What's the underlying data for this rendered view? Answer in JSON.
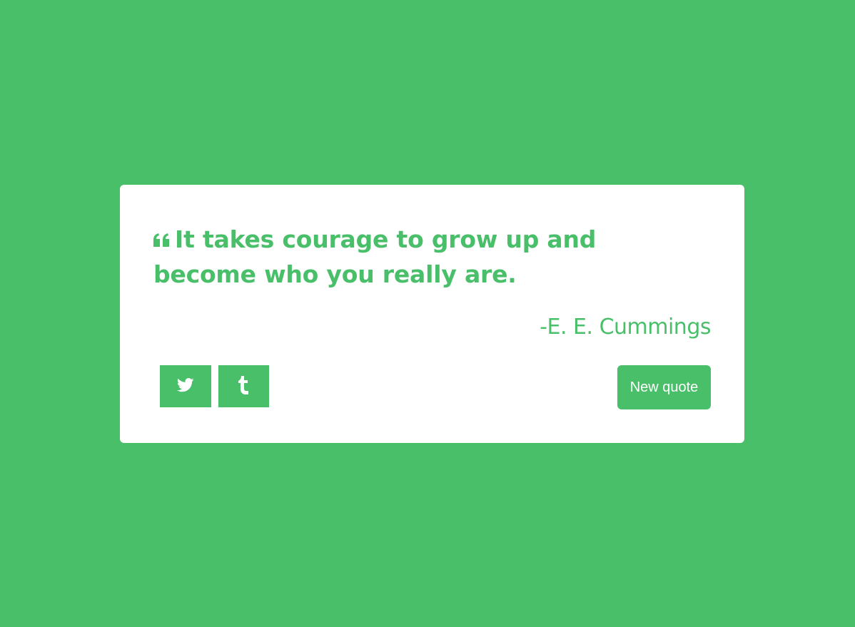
{
  "colors": {
    "background": "#49bf6a",
    "accent": "#49bf6a",
    "card": "#ffffff"
  },
  "quote": {
    "icon": "quote-left-icon",
    "text": "It takes courage to grow up and become who you really are.",
    "author": "-E. E. Cummings"
  },
  "actions": {
    "twitter_icon": "twitter-icon",
    "tumblr_icon": "tumblr-icon",
    "new_quote_label": "New quote"
  }
}
